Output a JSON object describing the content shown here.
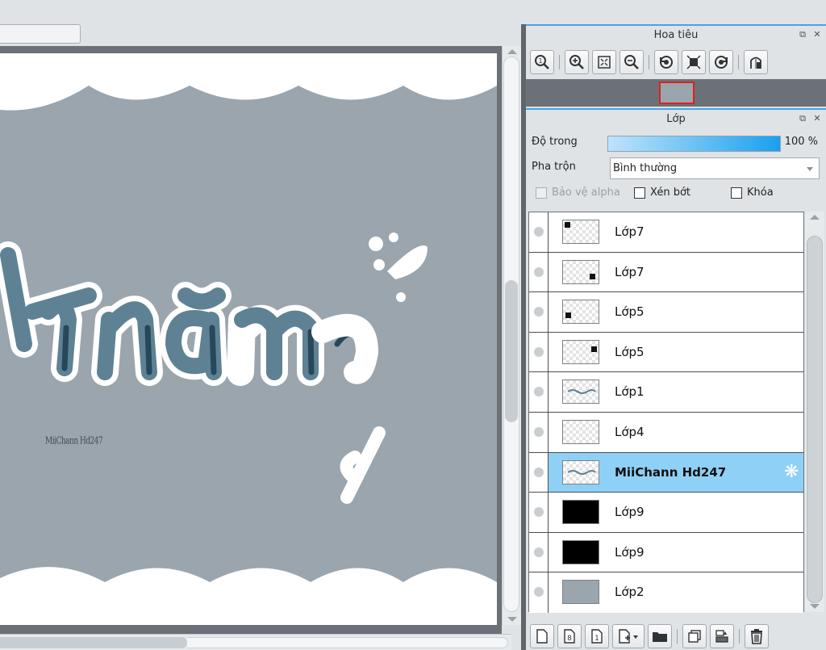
{
  "navigator": {
    "title": "Hoa tiêu",
    "toolbar": [
      {
        "name": "zoom-actual-icon"
      },
      {
        "name": "zoom-in-icon"
      },
      {
        "name": "fit-screen-icon"
      },
      {
        "name": "zoom-out-icon"
      },
      {
        "name": "rotate-left-icon"
      },
      {
        "name": "fit-canvas-icon"
      },
      {
        "name": "rotate-right-icon"
      },
      {
        "name": "flip-horizontal-icon"
      }
    ]
  },
  "layers_panel": {
    "title": "Lớp",
    "opacity_label": "Độ trong",
    "opacity_value": "100 %",
    "opacity_fraction": 1.0,
    "blend_label": "Pha trộn",
    "blend_value": "Bình thường",
    "protect_alpha_label": "Bảo vệ alpha",
    "clipping_label": "Xén bớt",
    "lock_label": "Khóa",
    "layers": [
      {
        "name": "Lớp7",
        "thumb": "checker-mark-tl",
        "selected": false
      },
      {
        "name": "Lớp7",
        "thumb": "checker-mark-br",
        "selected": false
      },
      {
        "name": "Lớp5",
        "thumb": "checker-mark-bl",
        "selected": false
      },
      {
        "name": "Lớp5",
        "thumb": "checker-mark-tr",
        "selected": false
      },
      {
        "name": "Lớp1",
        "thumb": "checker-text",
        "selected": false
      },
      {
        "name": "Lớp4",
        "thumb": "checker",
        "selected": false
      },
      {
        "name": "MiiChann Hd247",
        "thumb": "checker-text",
        "selected": true
      },
      {
        "name": "Lớp9",
        "thumb": "black",
        "selected": false
      },
      {
        "name": "Lớp9",
        "thumb": "black",
        "selected": false
      },
      {
        "name": "Lớp2",
        "thumb": "gray",
        "selected": false
      }
    ],
    "bottom_toolbar": [
      {
        "name": "new-layer-icon"
      },
      {
        "name": "new-8bit-layer-icon"
      },
      {
        "name": "new-1bit-layer-icon"
      },
      {
        "name": "add-layer-menu-icon"
      },
      {
        "name": "folder-icon"
      },
      {
        "name": "duplicate-layer-icon"
      },
      {
        "name": "merge-layer-icon"
      },
      {
        "name": "delete-layer-icon"
      }
    ]
  },
  "canvas": {
    "text": "ột năm",
    "watermark": "MiiChann Hd247",
    "colors": {
      "background": "#9aa5ad",
      "paper": "#ffffff",
      "text_fill": "#5e8294",
      "text_dark": "#27475a"
    }
  },
  "colors": {
    "accent": "#4aa3df",
    "selected_row": "#8fd0f6",
    "panel_bg": "#dfe3e6"
  }
}
